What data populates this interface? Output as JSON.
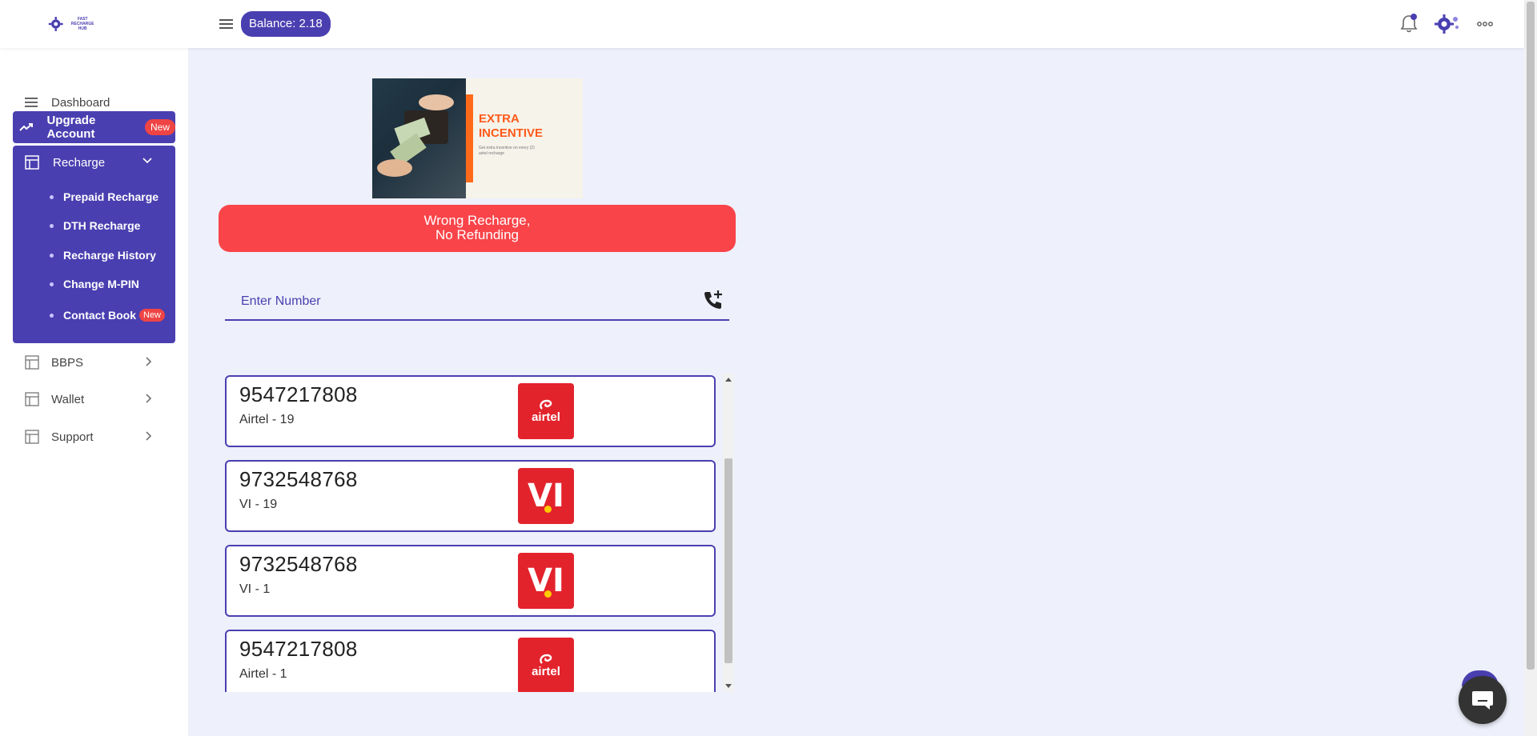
{
  "header": {
    "logo_text_line1": "FAST RECHARGE",
    "logo_text_line2": "HUB",
    "balance_label": "Balance: 2.18"
  },
  "sidebar": {
    "dashboard": "Dashboard",
    "upgrade": "Upgrade Account",
    "upgrade_badge": "New",
    "recharge": "Recharge",
    "sub_items": [
      {
        "label": "Prepaid Recharge"
      },
      {
        "label": "DTH Recharge"
      },
      {
        "label": "Recharge History"
      },
      {
        "label": "Change M-PIN"
      },
      {
        "label": "Contact Book",
        "badge": "New"
      }
    ],
    "bbps": "BBPS",
    "wallet": "Wallet",
    "support": "Support"
  },
  "banner": {
    "title_line1": "EXTRA",
    "title_line2": "INCENTIVE",
    "subtitle": "Get extra incentive on every (2) airtel recharge"
  },
  "alert": {
    "line1": "Wrong Recharge,",
    "line2": "No Refunding"
  },
  "search": {
    "placeholder": "Enter Number"
  },
  "history": [
    {
      "number": "9547217808",
      "operator": "Airtel - 19",
      "logo": "airtel"
    },
    {
      "number": "9732548768",
      "operator": "VI - 19",
      "logo": "vi"
    },
    {
      "number": "9732548768",
      "operator": "VI - 1",
      "logo": "vi"
    },
    {
      "number": "9547217808",
      "operator": "Airtel - 1",
      "logo": "airtel"
    }
  ],
  "logos": {
    "airtel_text": "airtel",
    "vi_text": "VI"
  },
  "colors": {
    "primary": "#4a3fb0",
    "alert": "#f94449",
    "operator_red": "#e3232c"
  }
}
